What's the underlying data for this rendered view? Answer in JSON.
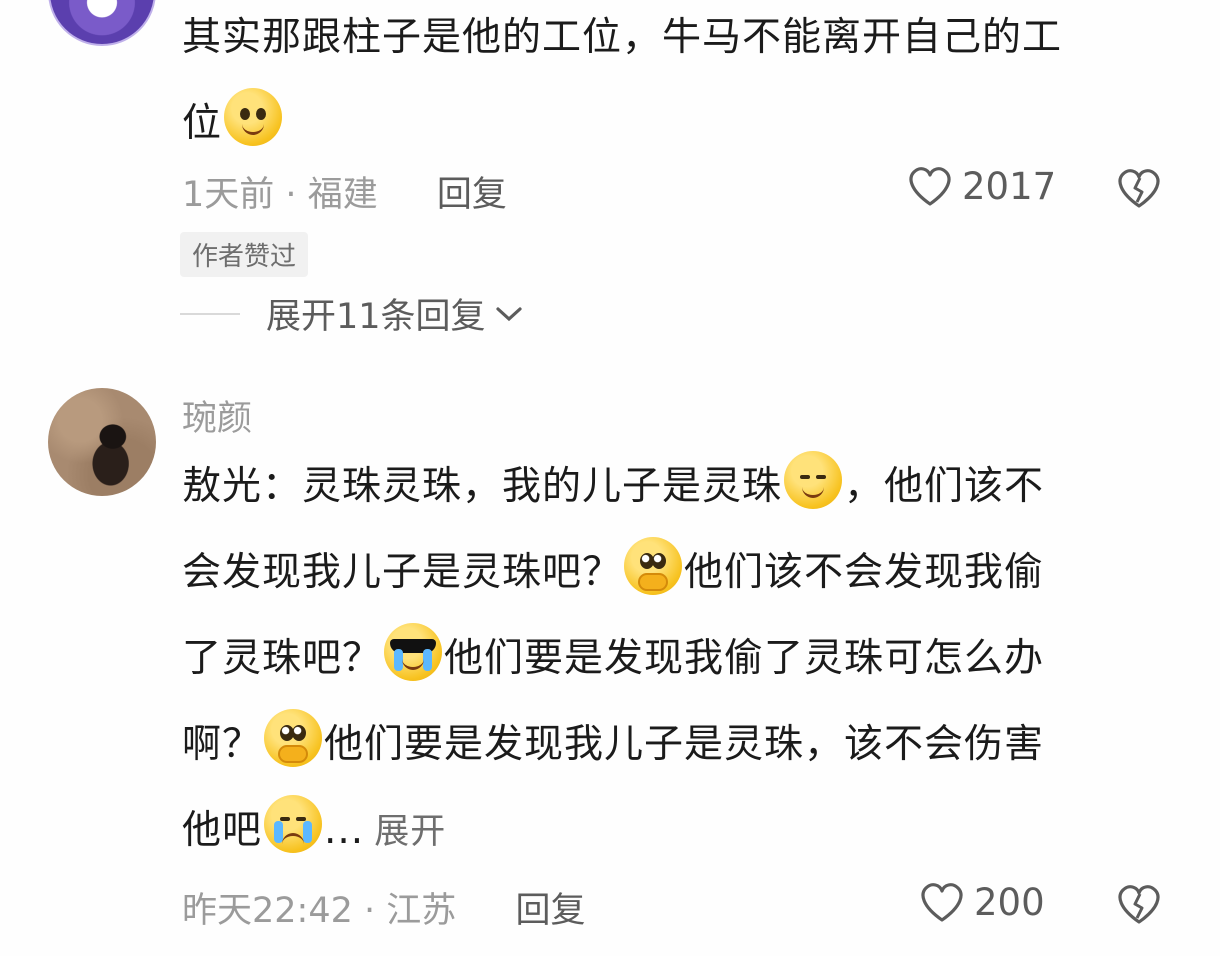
{
  "comment1": {
    "text_line1": "其实那跟柱子是他的工位，牛马不能离开自己的工",
    "text_line2": "位",
    "emoji_1": "smile-emoji",
    "time": "1天前",
    "sep": "·",
    "location": "福建",
    "reply_label": "回复",
    "like_count": "2017",
    "badge": "作者赞过",
    "expand_replies": "展开11条回复"
  },
  "comment2": {
    "username": "琬颜",
    "line1_a": "敖光：灵珠灵珠，我的儿子是灵珠",
    "line1_b": "，他们该不",
    "line2_a": "会发现我儿子是灵珠吧？",
    "line2_b": "他们该不会发现我偷",
    "line3_a": "了灵珠吧？",
    "line3_b": "他们要是发现我偷了灵珠可怎么办",
    "line4_a": "啊？",
    "line4_b": "他们要是发现我儿子是灵珠，该不会伤害",
    "line5_a": "他吧",
    "ellipsis": "...",
    "expand": "展开",
    "time": "昨天22:42",
    "sep": "·",
    "location": "江苏",
    "reply_label": "回复",
    "like_count": "200"
  },
  "icons": [
    "heart-outline-icon",
    "broken-heart-icon",
    "chevron-down-icon"
  ],
  "colors": {
    "text": "#1b1b1b",
    "meta": "#9b9b9b",
    "action": "#5c5c5c"
  }
}
